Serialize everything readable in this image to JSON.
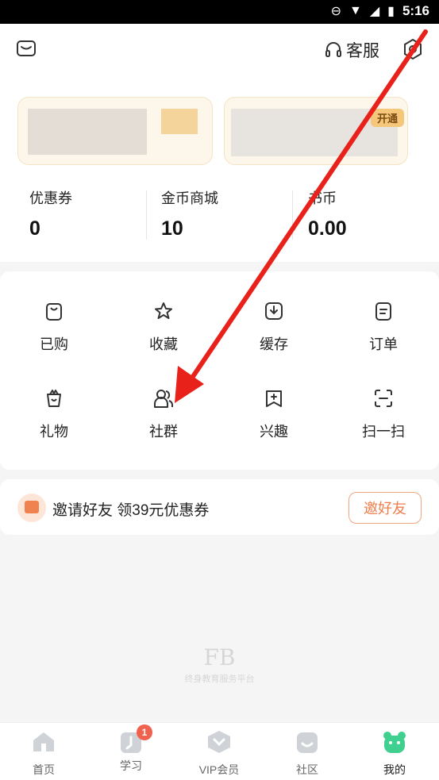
{
  "status_bar": {
    "time": "5:16"
  },
  "header": {
    "service_label": "客服"
  },
  "vip_card": {
    "open_label": "开通"
  },
  "stats": [
    {
      "label": "优惠券",
      "value": "0"
    },
    {
      "label": "金币商城",
      "value": "10"
    },
    {
      "label": "书币",
      "value": "0.00"
    }
  ],
  "grid": {
    "items": [
      {
        "label": "已购",
        "icon": "bag-icon"
      },
      {
        "label": "收藏",
        "icon": "star-icon"
      },
      {
        "label": "缓存",
        "icon": "download-icon"
      },
      {
        "label": "订单",
        "icon": "order-icon"
      },
      {
        "label": "礼物",
        "icon": "gift-icon"
      },
      {
        "label": "社群",
        "icon": "community-icon"
      },
      {
        "label": "兴趣",
        "icon": "interest-icon"
      },
      {
        "label": "扫一扫",
        "icon": "scan-icon"
      }
    ]
  },
  "invite": {
    "text": "邀请好友 领39元优惠券",
    "button": "邀好友"
  },
  "watermark": {
    "logo": "FB",
    "tagline": "终身教育服务平台"
  },
  "tabs": [
    {
      "label": "首页",
      "icon": "home-icon"
    },
    {
      "label": "学习",
      "icon": "study-icon",
      "badge": "1"
    },
    {
      "label": "VIP会员",
      "icon": "vip-icon"
    },
    {
      "label": "社区",
      "icon": "community-tab-icon"
    },
    {
      "label": "我的",
      "icon": "profile-icon"
    }
  ],
  "colors": {
    "accent": "#ef7d4b",
    "badge": "#f0624d",
    "arrow": "#e8221b",
    "card_bg": "#fdf6ea"
  }
}
